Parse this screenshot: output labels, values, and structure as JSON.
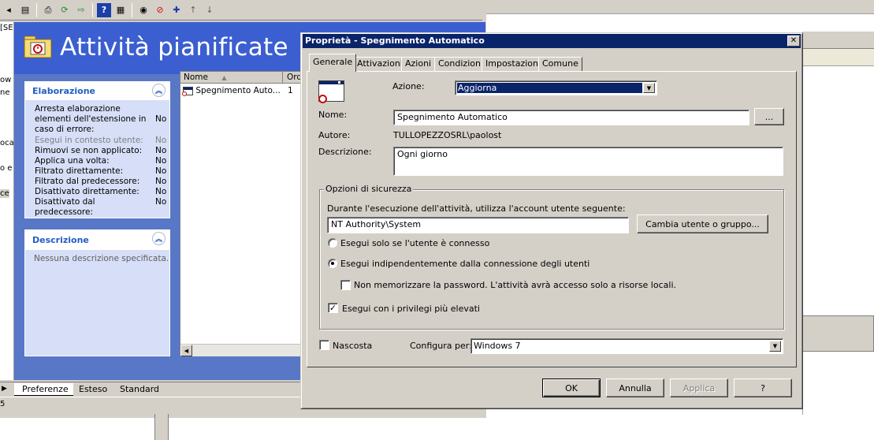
{
  "background": {
    "toolbar_icons": [
      "back-icon",
      "properties-icon",
      "print-icon",
      "refresh-icon",
      "export-icon",
      "help-icon",
      "view-icon",
      "run-icon",
      "stop-icon",
      "add-icon",
      "up-icon",
      "down-icon"
    ],
    "left_strip_fragments": [
      "[SE",
      "ow",
      "ne",
      "oca",
      "o e",
      "ce"
    ],
    "panel_title": "Attività pianificate",
    "tasks_section": {
      "title": "Elaborazione",
      "rows": [
        {
          "label": "Arresta elaborazione elementi dell'estensione in caso di errore:",
          "value": "No",
          "disabled": false
        },
        {
          "label": "Esegui in contesto utente:",
          "value": "No",
          "disabled": true
        },
        {
          "label": "Rimuovi se non applicato:",
          "value": "No",
          "disabled": false
        },
        {
          "label": "Applica una volta:",
          "value": "No",
          "disabled": false
        },
        {
          "label": "Filtrato direttamente:",
          "value": "No",
          "disabled": false
        },
        {
          "label": "Filtrato dal predecessore:",
          "value": "No",
          "disabled": false
        },
        {
          "label": "Disattivato direttamente:",
          "value": "No",
          "disabled": false
        },
        {
          "label": "Disattivato dal predecessore:",
          "value": "No",
          "disabled": false
        }
      ]
    },
    "description_section": {
      "title": "Descrizione",
      "text": "Nessuna descrizione specificata."
    },
    "list": {
      "columns": [
        "Nome",
        "Ord"
      ],
      "rows": [
        {
          "name": "Spegnimento Auto...",
          "order": "1"
        }
      ]
    },
    "bottom_tabs": [
      "Preferenze",
      "Esteso",
      "Standard"
    ],
    "status_text": "5"
  },
  "dialog": {
    "title": "Proprietà - Spegnimento Automatico",
    "close_label": "✕",
    "tabs": [
      "Generale",
      "Attivazioni",
      "Azioni",
      "Condizioni",
      "Impostazioni",
      "Comune"
    ],
    "active_tab": "Generale",
    "action_label": "Azione:",
    "action_value": "Aggiorna",
    "name_label": "Nome:",
    "name_value": "Spegnimento Automatico",
    "browse_label": "...",
    "author_label": "Autore:",
    "author_value": "TULLOPEZZOSRL\\paolost",
    "description_label": "Descrizione:",
    "description_value": "Ogni giorno",
    "security": {
      "group_label": "Opzioni di sicurezza",
      "account_prompt": "Durante l'esecuzione dell'attività, utilizza l'account utente seguente:",
      "account_value": "NT Authority\\System",
      "change_user_label": "Cambia utente o gruppo...",
      "radio_logged_on": "Esegui solo se l'utente è connesso",
      "radio_always": "Esegui indipendentemente dalla connessione degli utenti",
      "no_store_password": "Non memorizzare la password. L'attività avrà accesso solo a risorse locali.",
      "highest_privileges": "Esegui con i privilegi più elevati"
    },
    "hidden_label": "Nascosta",
    "configure_label": "Configura per:",
    "configure_value": "Windows 7",
    "buttons": {
      "ok": "OK",
      "cancel": "Annulla",
      "apply": "Applica",
      "help": "?"
    }
  },
  "colors": {
    "titlebar": "#0a246a",
    "panel_blue": "#5877c7",
    "link_blue": "#215dc6"
  }
}
